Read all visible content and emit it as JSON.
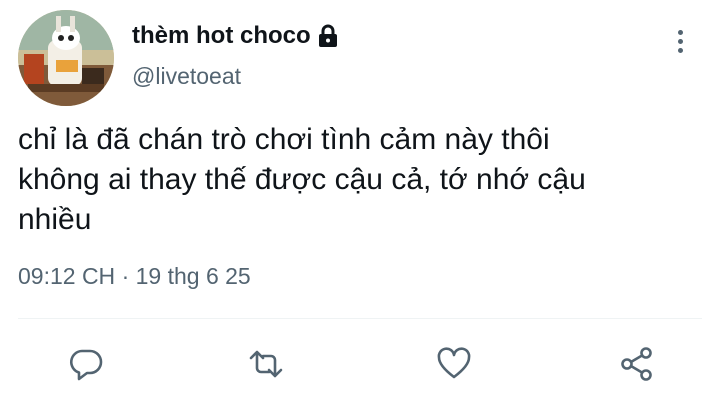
{
  "user": {
    "display_name": "thèm hot choco",
    "handle": "@livetoeat",
    "protected_icon": "lock-icon",
    "avatar": "avatar-image"
  },
  "tweet": {
    "text": "chỉ là đã chán trò chơi tình cảm này thôi\nkhông ai thay thế được cậu cả, tớ nhớ cậu\nnhiều",
    "time": "09:12 CH",
    "separator": "·",
    "date": "19 thg 6 25"
  },
  "actions": [
    {
      "name": "reply",
      "icon": "reply-icon"
    },
    {
      "name": "retweet",
      "icon": "retweet-icon"
    },
    {
      "name": "like",
      "icon": "heart-icon"
    },
    {
      "name": "share",
      "icon": "share-icon"
    }
  ],
  "colors": {
    "text": "#0f1419",
    "secondary": "#536471",
    "divider": "#eff3f4"
  }
}
